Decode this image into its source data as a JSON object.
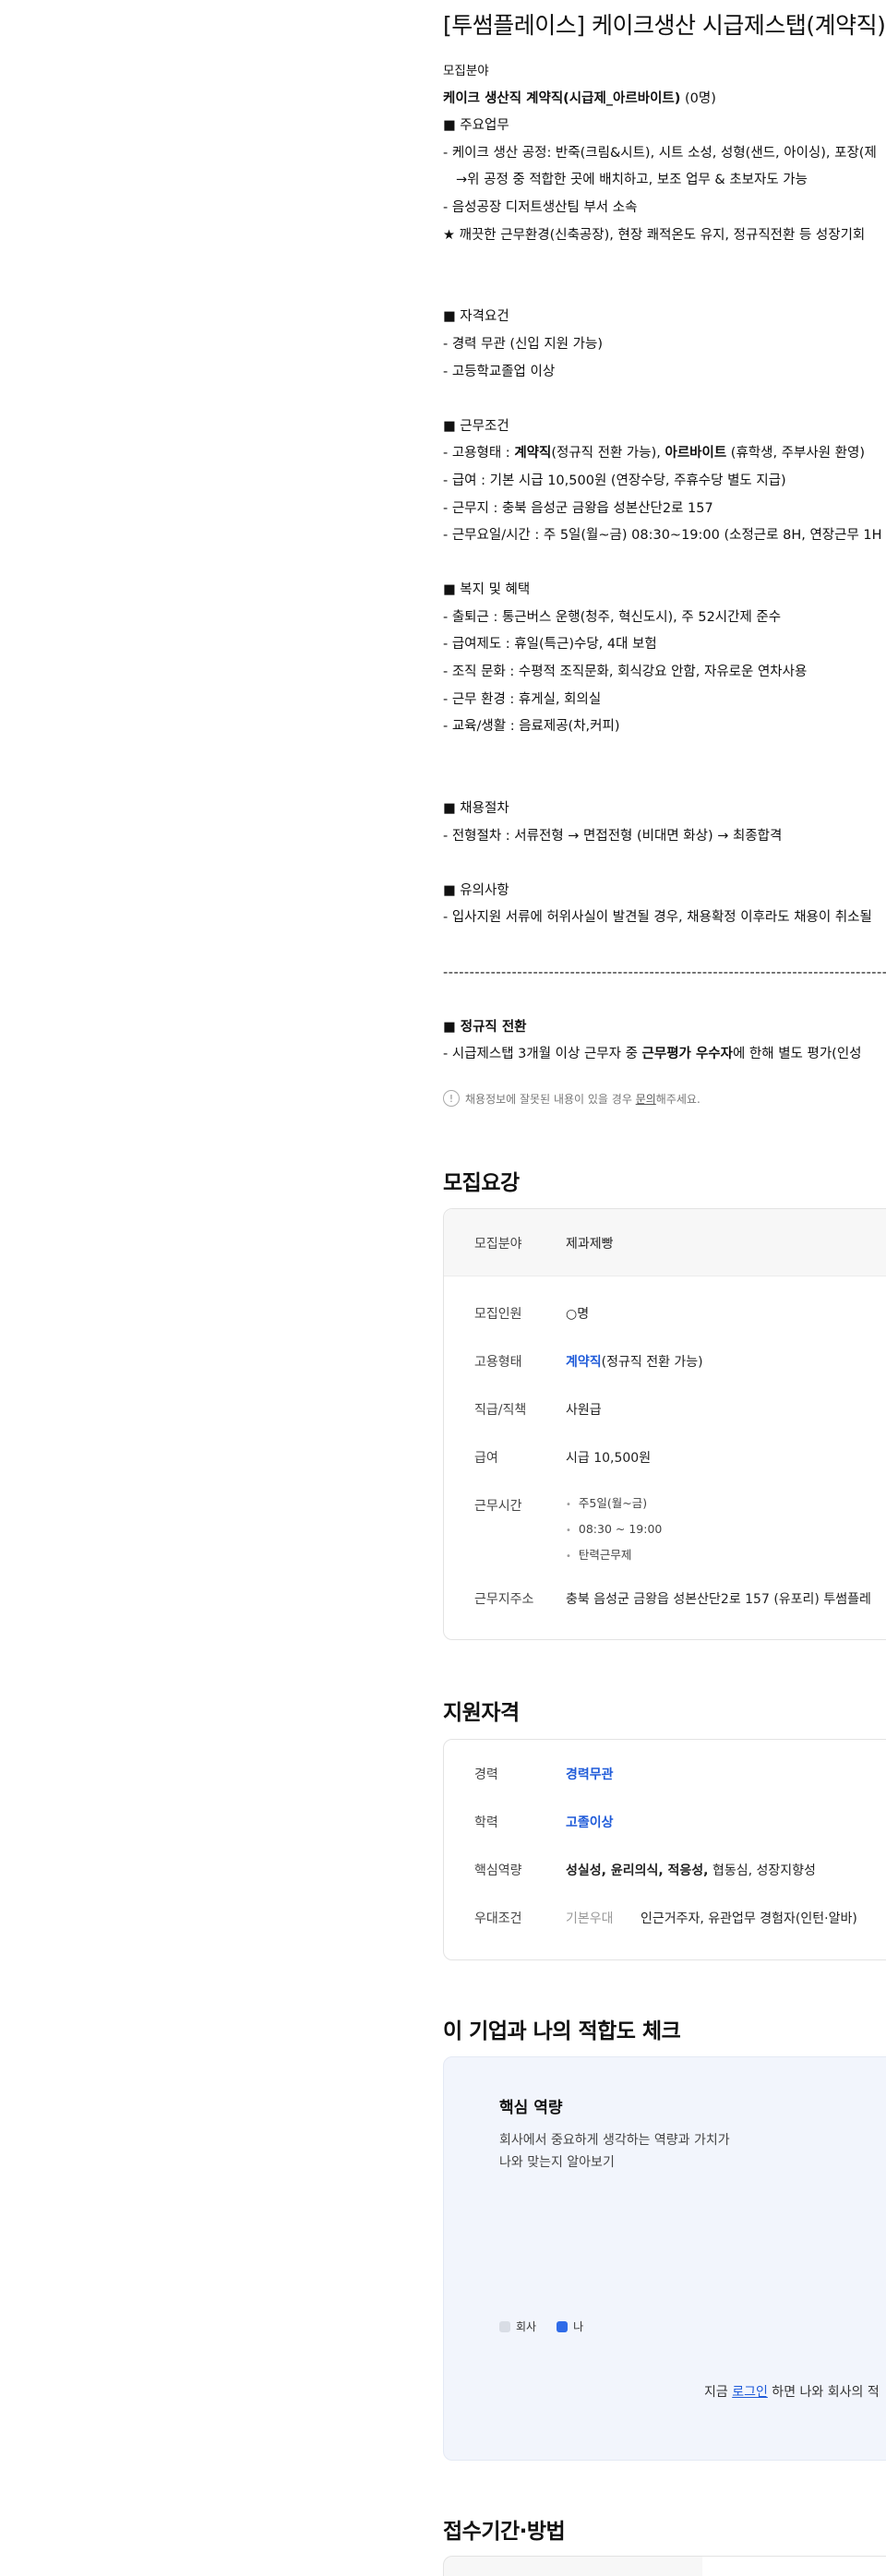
{
  "posting": {
    "title": "[투썸플레이스] 케이크생산 시급제스탭(계약직) 모집",
    "field_heading": "모집분야",
    "field_value": "케이크 생산직 계약직(시급제_아르바이트)",
    "field_count": "(0명)",
    "duties_heading": "■ 주요업무",
    "duty_1": "- 케이크 생산 공정:  반죽(크림&시트), 시트 소성, 성형(샌드, 아이싱), 포장(제",
    "duty_2": "  →위 공정 중 적합한 곳에 배치하고, 보조 업무 & 초보자도 가능",
    "duty_3": "- 음성공장 디저트생산팀 부서 소속",
    "duty_4": "★ 깨끗한 근무환경(신축공장), 현장 쾌적온도 유지, 정규직전환  등 성장기회",
    "qual_heading": "■ 자격요건",
    "qual_1": "- 경력 무관 (신입 지원 가능)",
    "qual_2": "- 고등학교졸업 이상",
    "cond_heading": "■ 근무조건",
    "cond_1_pre": "- 고용형태 : ",
    "cond_1_b1": "계약직",
    "cond_1_mid": "(정규직 전환 가능), ",
    "cond_1_b2": "아르바이트",
    "cond_1_post": " (휴학생, 주부사원 환영)",
    "cond_2": "- 급여 : 기본 시급 10,500원 (연장수당, 주휴수당 별도 지급)",
    "cond_3": "- 근무지 : 충북 음성군 금왕읍 성본산단2로 157",
    "cond_4": "- 근무요일/시간 : 주 5일(월~금) 08:30~19:00 (소정근로 8H, 연장근무 1H",
    "welfare_heading": "■ 복지 및 혜택",
    "welfare_1": "- 출퇴근 : 통근버스 운행(청주, 혁신도시), 주 52시간제 준수",
    "welfare_2": "- 급여제도 : 휴일(특근)수당, 4대 보험",
    "welfare_3": "- 조직 문화 : 수평적 조직문화, 회식강요 안함, 자유로운 연차사용",
    "welfare_4": "- 근무 환경 : 휴게실, 회의실",
    "welfare_5": "- 교육/생활 : 음료제공(차,커피)",
    "process_heading": "■ 채용절차",
    "process_1": "- 전형절차 : 서류전형 → 면접전형 (비대면 화상) → 최종합격",
    "caution_heading": "■ 유의사항",
    "caution_1": "- 입사지원 서류에 허위사실이 발견될 경우, 채용확정 이후라도 채용이 취소될",
    "divider": "----------------------------------------------------------------------------------------------------",
    "convert_heading": "■ 정규직 전환",
    "convert_1_pre": " - 시급제스탭 3개월 이상 근무자 중 ",
    "convert_1_b": "근무평가 우수자",
    "convert_1_post": "에 한해 별도 평가(인성",
    "notice_icon": "!",
    "notice_pre": "채용정보에 잘못된 내용이 있을 경우 ",
    "notice_link": "문의",
    "notice_post": "해주세요."
  },
  "summary": {
    "heading": "모집요강",
    "field_label": "모집분야",
    "field_value": "제과제빵",
    "count_label": "모집인원",
    "count_value": "○명",
    "type_label": "고용형태",
    "type_value_blue": "계약직",
    "type_value_rest": "(정규직 전환 가능)",
    "rank_label": "직급/직책",
    "rank_value": "사원급",
    "salary_label": "급여",
    "salary_value": "시급 10,500원",
    "hours_label": "근무시간",
    "hours": [
      "주5일(월~금)",
      "08:30 ~ 19:00",
      "탄력근무제"
    ],
    "address_label": "근무지주소",
    "address_value": "충북 음성군 금왕읍 성본산단2로 157 (유포리) 투썸플레"
  },
  "eligibility": {
    "heading": "지원자격",
    "career_label": "경력",
    "career_value": "경력무관",
    "edu_label": "학력",
    "edu_value": "고졸이상",
    "core_label": "핵심역량",
    "core_value_bold": "성실성, 윤리의식, 적응성,",
    "core_value_rest": " 협동심, 성장지향성",
    "pref_label": "우대조건",
    "pref_tag": "기본우대",
    "pref_value": "인근거주자, 유관업무 경험자(인턴·알바)"
  },
  "fit": {
    "heading": "이 기업과 나의 적합도 체크",
    "card_title": "핵심 역량",
    "desc_1": "회사에서 중요하게 생각하는 역량과 가치가",
    "desc_2": "나와 맞는지 알아보기",
    "legend_company": "회사",
    "legend_me": "나",
    "login_pre": "지금 ",
    "login_link": "로그인",
    "login_post": " 하면 나와 회사의 적",
    "colors": {
      "company": "#d9dde5",
      "me": "#2f6be8"
    }
  },
  "apply": {
    "heading": "접수기간·방법"
  }
}
